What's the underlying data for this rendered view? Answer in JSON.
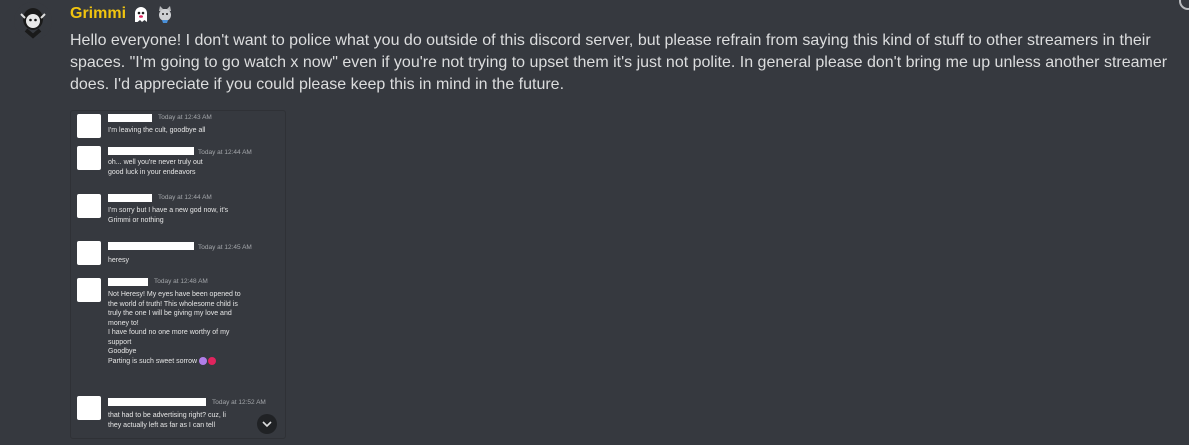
{
  "message": {
    "username": "Grimmi",
    "badges": [
      "ghost-icon",
      "cat-icon"
    ],
    "text": "Hello everyone! I don't want to police what you do outside of this discord server, but please refrain from saying this kind of stuff to other streamers in their spaces. \"I'm going to go watch x now\" even if you're not trying to upset them it's just not polite. In general please don't bring me up unless another streamer does. I'd appreciate if you could please keep this in mind in the future."
  },
  "attachment": {
    "messages": [
      {
        "time": "Today at 12:43 AM",
        "lines": [
          "I'm leaving the cult, goodbye all"
        ]
      },
      {
        "time": "Today at 12:44 AM",
        "lines": [
          "oh... well you're never truly out",
          "good luck in your endeavors"
        ]
      },
      {
        "time": "Today at 12:44 AM",
        "lines": [
          "I'm sorry but I have a new god now, it's",
          "Grimmi or nothing"
        ]
      },
      {
        "time": "Today at 12:45 AM",
        "lines": [
          "heresy"
        ]
      },
      {
        "time": "Today at 12:48 AM",
        "lines": [
          "Not Heresy! My eyes have been opened to",
          "the world of truth! This wholesome child is",
          "truly the one I will be giving my love and",
          "money to!",
          "I have found no one more worthy of my",
          "support",
          "Goodbye",
          "Parting is such sweet sorrow"
        ]
      },
      {
        "time": "Today at 12:52 AM",
        "lines": [
          "that had to be advertising right? cuz, li",
          "they actually left as far as I can tell"
        ]
      }
    ],
    "heart_colors": [
      "#b07ee8",
      "#e0245e"
    ]
  }
}
